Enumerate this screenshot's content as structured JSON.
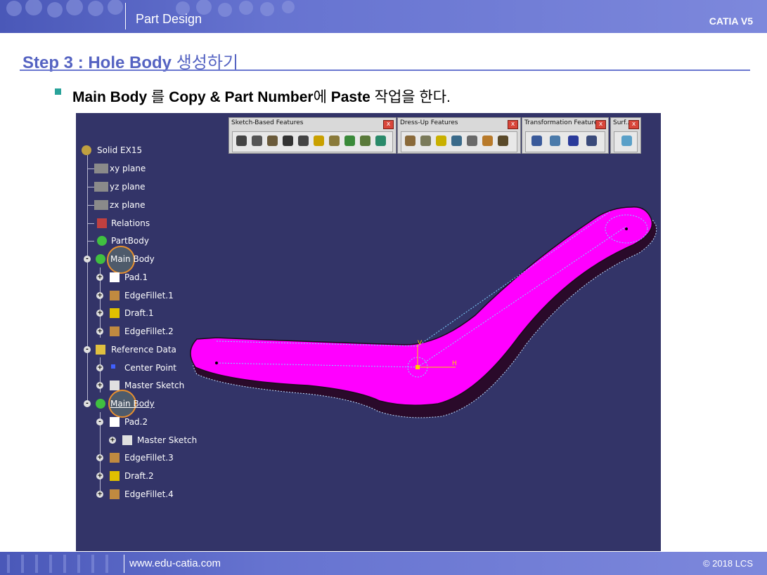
{
  "header": {
    "title": "Part Design",
    "product": "CATIA V5"
  },
  "step": {
    "prefix": "Step 3 : Hole Body",
    "suffix": "생성하기"
  },
  "instruction": {
    "p1": "Main Body",
    "p2": "를",
    "p3": "Copy & Part Number",
    "p4": "에",
    "p5": "Paste",
    "p6": "작업을 한다."
  },
  "toolbars": [
    {
      "title": "Sketch-Based Features",
      "close": "x"
    },
    {
      "title": "Dress-Up Features",
      "close": "x"
    },
    {
      "title": "Transformation Features",
      "close": "x"
    },
    {
      "title": "Surf...",
      "close": "x"
    }
  ],
  "tree": [
    {
      "label": "Solid EX15",
      "icon": "part-icon"
    },
    {
      "label": "xy plane",
      "icon": "plane-icon"
    },
    {
      "label": "yz plane",
      "icon": "plane-icon"
    },
    {
      "label": "zx plane",
      "icon": "plane-icon"
    },
    {
      "label": "Relations",
      "icon": "relations-icon"
    },
    {
      "label": "PartBody",
      "icon": "body-icon"
    },
    {
      "label": "Main Body",
      "icon": "body-icon"
    },
    {
      "label": "Pad.1",
      "icon": "pad-icon"
    },
    {
      "label": "EdgeFillet.1",
      "icon": "edgefillet-icon"
    },
    {
      "label": "Draft.1",
      "icon": "draft-icon"
    },
    {
      "label": "EdgeFillet.2",
      "icon": "edgefillet-icon"
    },
    {
      "label": "Reference Data",
      "icon": "geometrical-set-icon"
    },
    {
      "label": "Center Point",
      "icon": "point-icon"
    },
    {
      "label": "Master Sketch",
      "icon": "sketch-icon"
    },
    {
      "label": "Main Body",
      "icon": "body-icon"
    },
    {
      "label": "Pad.2",
      "icon": "pad-icon"
    },
    {
      "label": "Master Sketch",
      "icon": "sketch-icon"
    },
    {
      "label": "EdgeFillet.3",
      "icon": "edgefillet-icon"
    },
    {
      "label": "Draft.2",
      "icon": "draft-icon"
    },
    {
      "label": "EdgeFillet.4",
      "icon": "edgefillet-icon"
    }
  ],
  "axis": {
    "v": "V",
    "h": "H"
  },
  "colors": {
    "part": "#ff00ff",
    "background": "#333468",
    "accent": "#5563c2",
    "highlight": "#e8902e"
  },
  "footer": {
    "url": "www.edu-catia.com",
    "copyright": "© 2018 LCS"
  }
}
